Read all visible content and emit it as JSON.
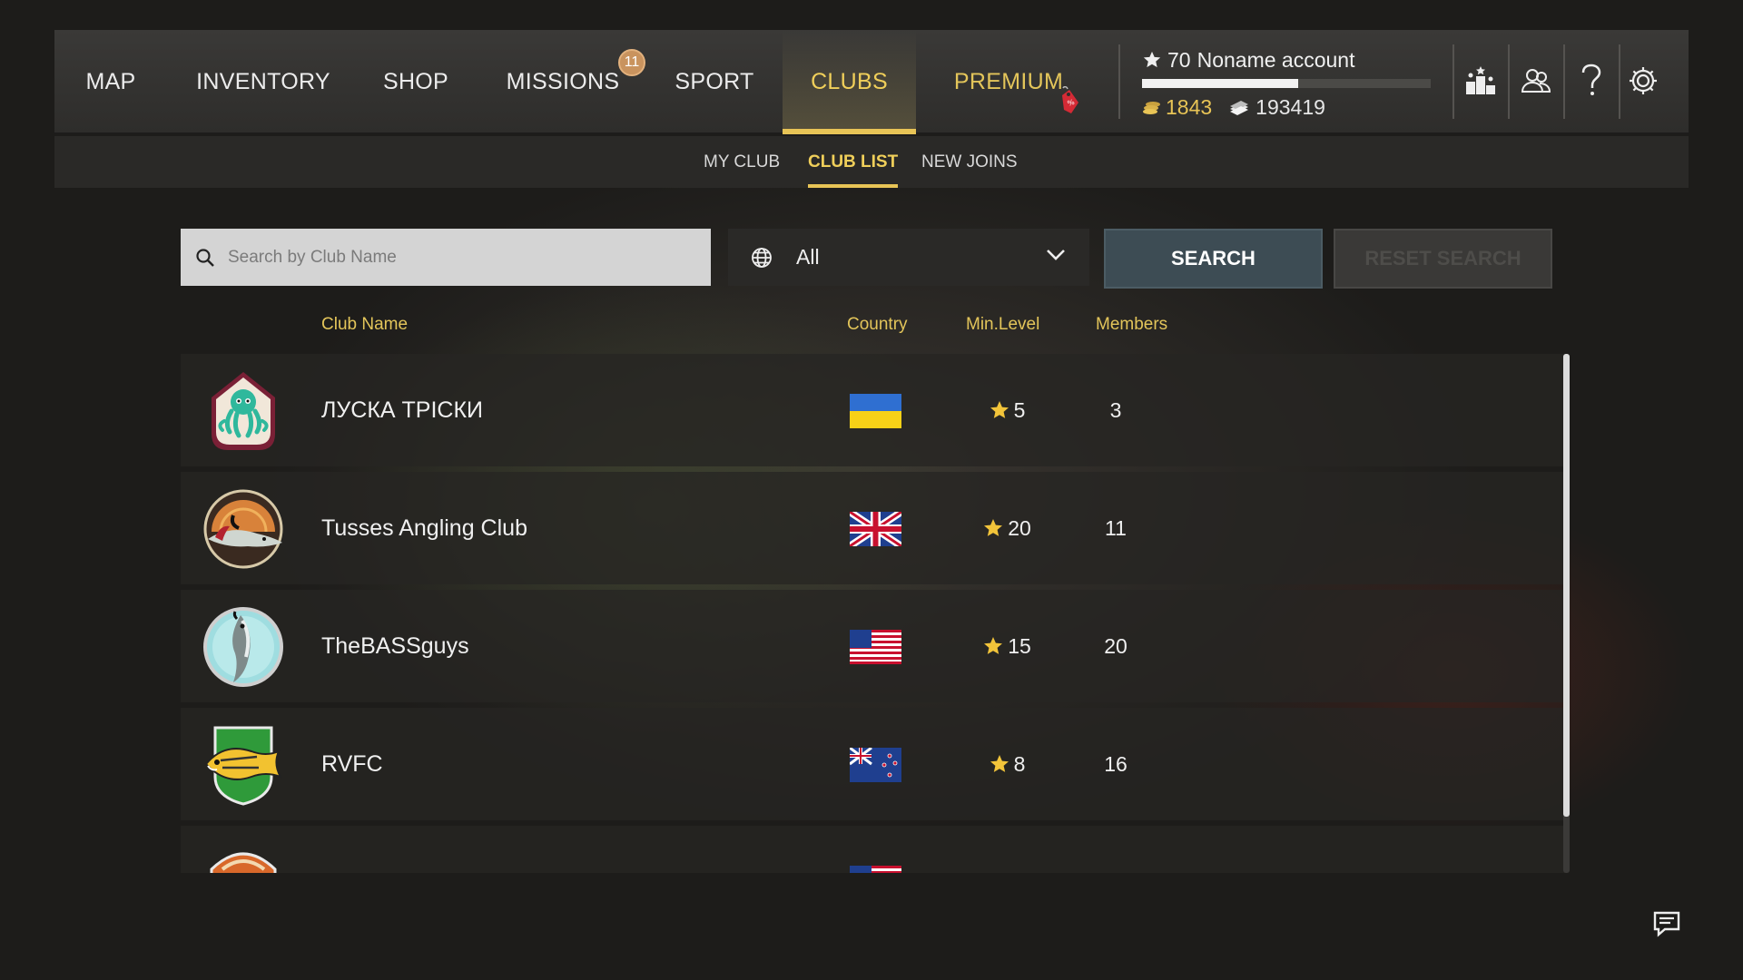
{
  "nav": {
    "items": [
      {
        "label": "MAP"
      },
      {
        "label": "INVENTORY"
      },
      {
        "label": "SHOP"
      },
      {
        "label": "MISSIONS",
        "badge": "11"
      },
      {
        "label": "SPORT"
      },
      {
        "label": "CLUBS",
        "active": true
      },
      {
        "label": "PREMIUM"
      }
    ]
  },
  "account": {
    "level": "70",
    "name": "Noname account",
    "xp_progress": 0.54,
    "gold": "1843",
    "credits": "193419"
  },
  "subnav": {
    "items": [
      "MY CLUB",
      "CLUB LIST",
      "NEW JOINS"
    ],
    "active": "CLUB LIST"
  },
  "search": {
    "placeholder": "Search by Club Name",
    "value": "",
    "country_filter": "All",
    "search_label": "SEARCH",
    "reset_label": "RESET SEARCH"
  },
  "table": {
    "headers": {
      "name": "Club Name",
      "country": "Country",
      "level": "Min.Level",
      "members": "Members"
    },
    "rows": [
      {
        "name": "ЛУСКА ТРІСКИ",
        "country": "Ukraine",
        "min_level": "5",
        "members": "3",
        "logo": "octopus-crest"
      },
      {
        "name": "Tusses Angling Club",
        "country": "United Kingdom",
        "min_level": "20",
        "members": "11",
        "logo": "pike-sunset"
      },
      {
        "name": "TheBASSguys",
        "country": "United States",
        "min_level": "15",
        "members": "20",
        "logo": "bass-circle"
      },
      {
        "name": "RVFC",
        "country": "New Zealand",
        "min_level": "8",
        "members": "16",
        "logo": "fish-shield"
      },
      {
        "name": "",
        "country": "United States",
        "min_level": "",
        "members": "",
        "logo": "orange-crest"
      }
    ]
  },
  "colors": {
    "accent": "#e8c456",
    "search_button": "#3d4c54"
  },
  "icons": [
    "search-icon",
    "globe-icon",
    "chevron-down-icon",
    "leaderboard-icon",
    "friends-icon",
    "help-icon",
    "settings-icon",
    "chat-icon",
    "star-icon",
    "gold-coins-icon",
    "credits-icon",
    "sale-tag-icon"
  ]
}
